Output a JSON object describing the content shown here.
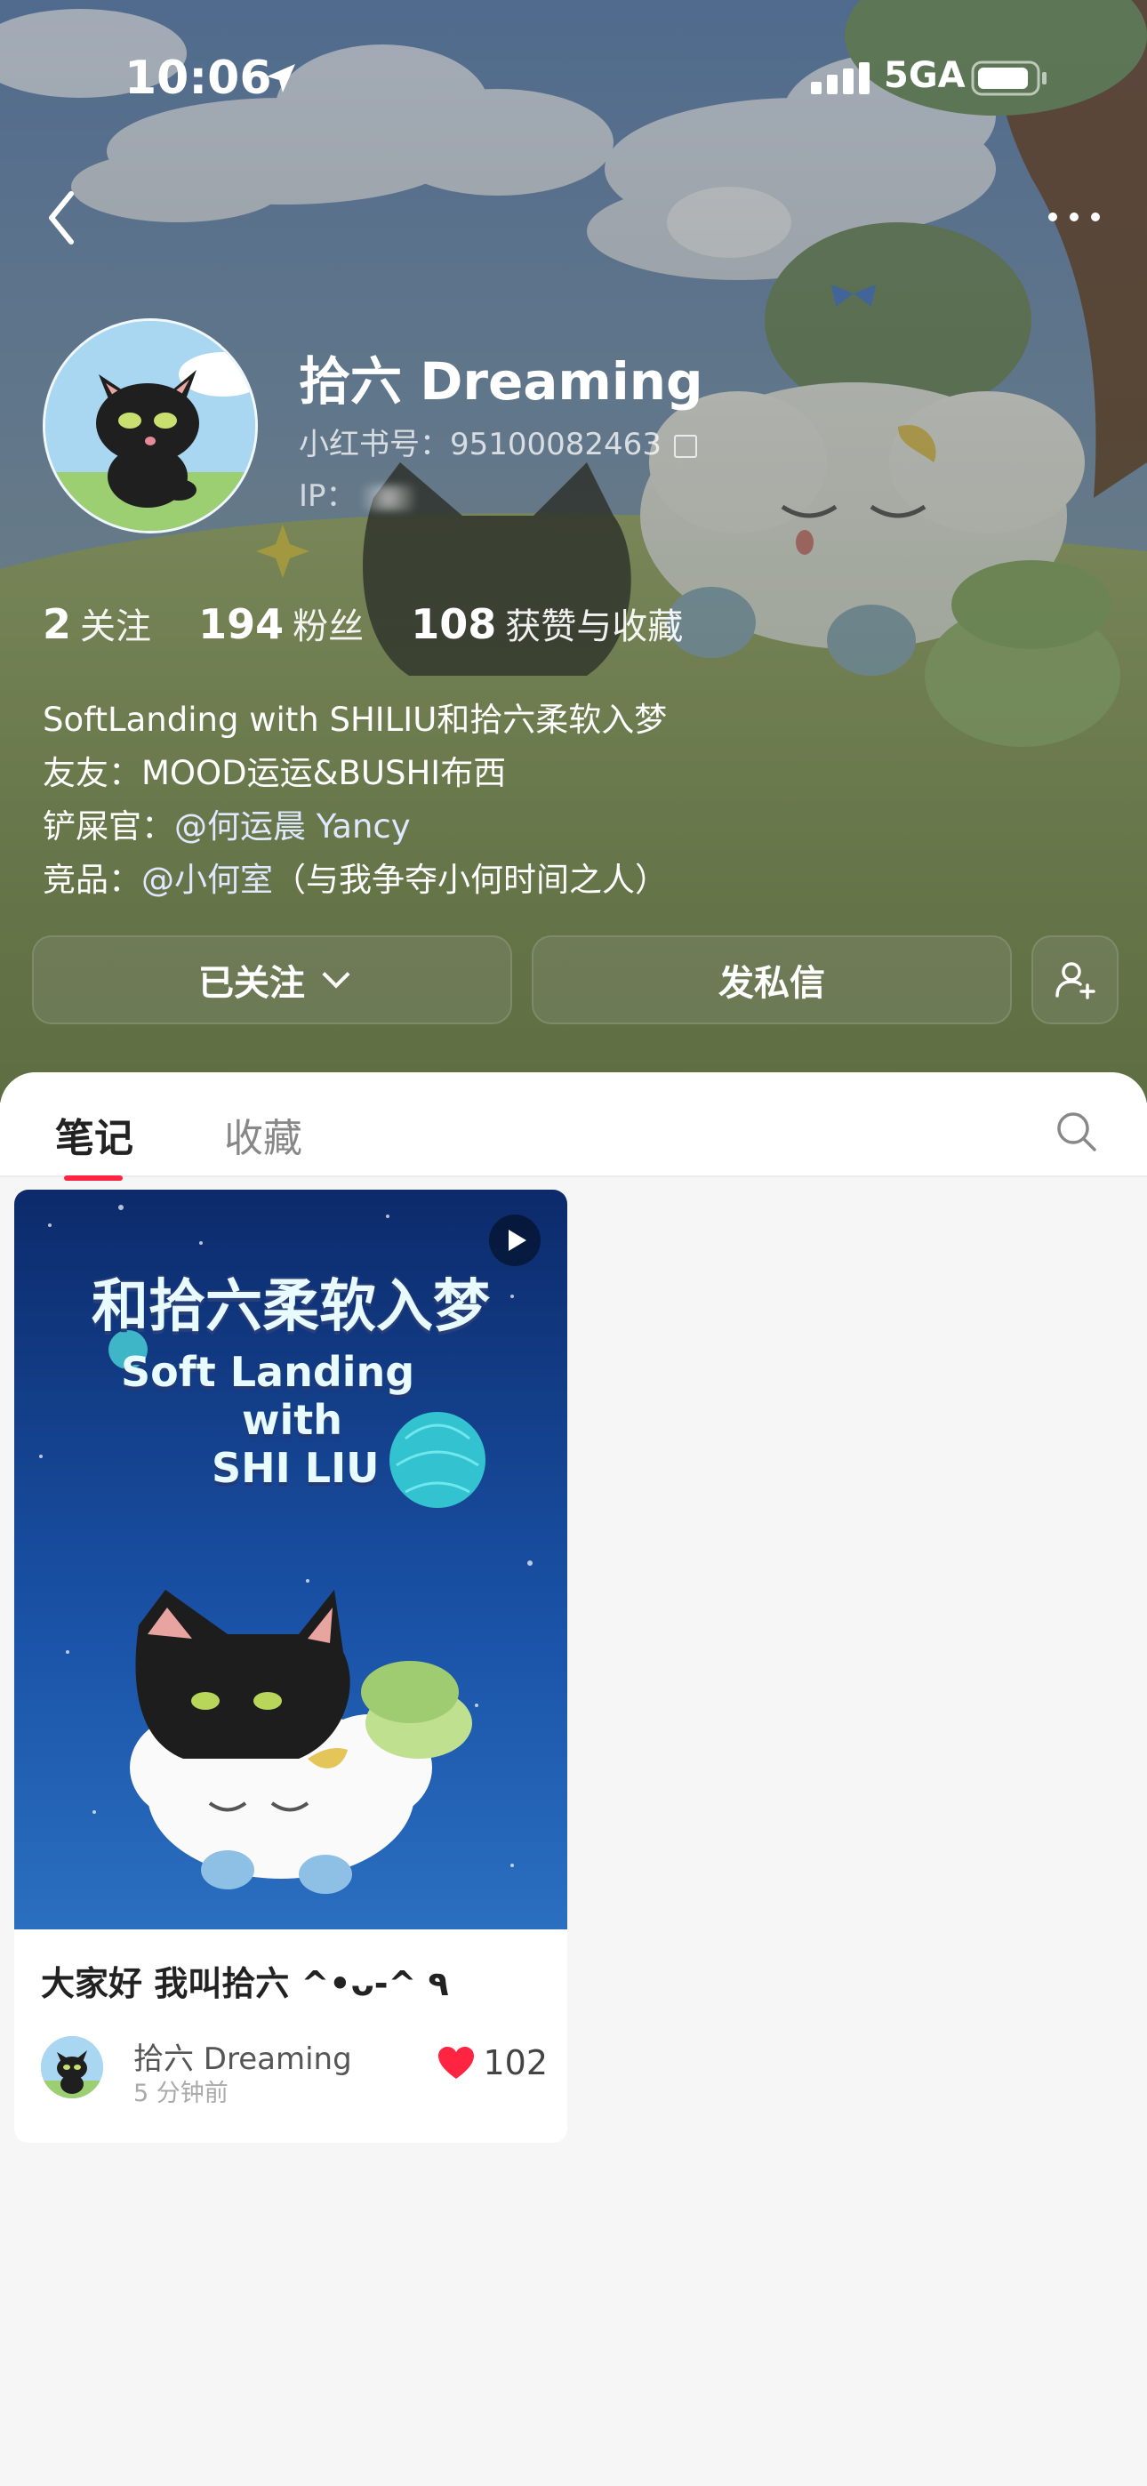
{
  "status_bar": {
    "time": "10:06",
    "network": "5GA"
  },
  "profile": {
    "name": "拾六 Dreaming",
    "red_id_label": "小红书号：",
    "red_id": "95100082463",
    "ip_label": "IP："
  },
  "stats": [
    {
      "value": "2",
      "label": "关注"
    },
    {
      "value": "194",
      "label": "粉丝"
    },
    {
      "value": "108",
      "label": "获赞与收藏"
    }
  ],
  "bio": {
    "line1": "SoftLanding with SHILIU和拾六柔软入梦",
    "line2": "友友：MOOD运运&BUSHI布西",
    "line3_prefix": "铲屎官：",
    "line3_mention": "@何运晨 Yancy",
    "line4_prefix": "竞品：",
    "line4_mention": "@小何室",
    "line4_suffix": "（与我争夺小何时间之人）"
  },
  "buttons": {
    "follow": "已关注",
    "message": "发私信"
  },
  "tabs": {
    "notes": "笔记",
    "favorites": "收藏"
  },
  "note": {
    "cover_title": "和拾六柔软入梦",
    "cover_line1": "Soft Landing",
    "cover_line2": "with",
    "cover_line3": "SHI LIU",
    "title": "大家好 我叫拾六 ^•ᴗ-^ ٩",
    "author": "拾六 Dreaming",
    "time_ago": "5 分钟前",
    "likes": "102"
  },
  "colors": {
    "accent": "#ff2442",
    "panel_bg": "#f6f6f6"
  },
  "icons": [
    "location-arrow-icon",
    "signal-icon",
    "battery-icon",
    "back-icon",
    "more-icon",
    "copy-icon",
    "chevron-down-icon",
    "add-friend-icon",
    "search-icon",
    "play-icon",
    "heart-icon"
  ]
}
